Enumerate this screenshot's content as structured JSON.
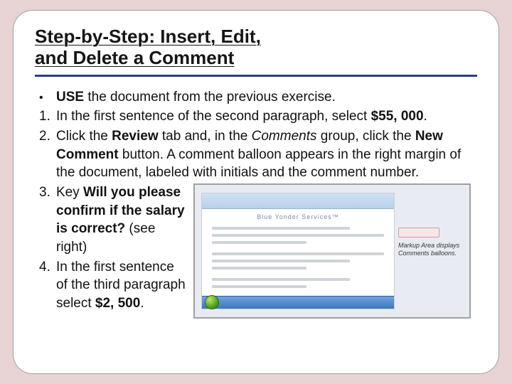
{
  "title_line1": "Step-by-Step: Insert, Edit,",
  "title_line2": "and Delete a Comment",
  "bullet": {
    "USE": "USE",
    "rest": " the document from the previous exercise."
  },
  "step1": {
    "a": "In the first sentence of the second paragraph, select ",
    "bold": "$55, 000",
    "b": "."
  },
  "step2": {
    "a": "Click the ",
    "review": "Review",
    "b": " tab and, in the ",
    "comments": "Comments",
    "c": " group, click the ",
    "newc": "New Comment",
    "d": " button. A comment balloon appears in the right margin of the document, labeled with initials and the comment number."
  },
  "step3": {
    "a": "Key ",
    "bold": "Will you please confirm if the salary is correct?",
    "b": " (see right)"
  },
  "step4": {
    "a": "In the first sentence of the third paragraph select ",
    "bold": "$2, 500",
    "b": "."
  },
  "shot": {
    "doc_title": "Blue Yonder Services™",
    "side1": "Markup Area displays",
    "side2": "Comments balloons."
  }
}
